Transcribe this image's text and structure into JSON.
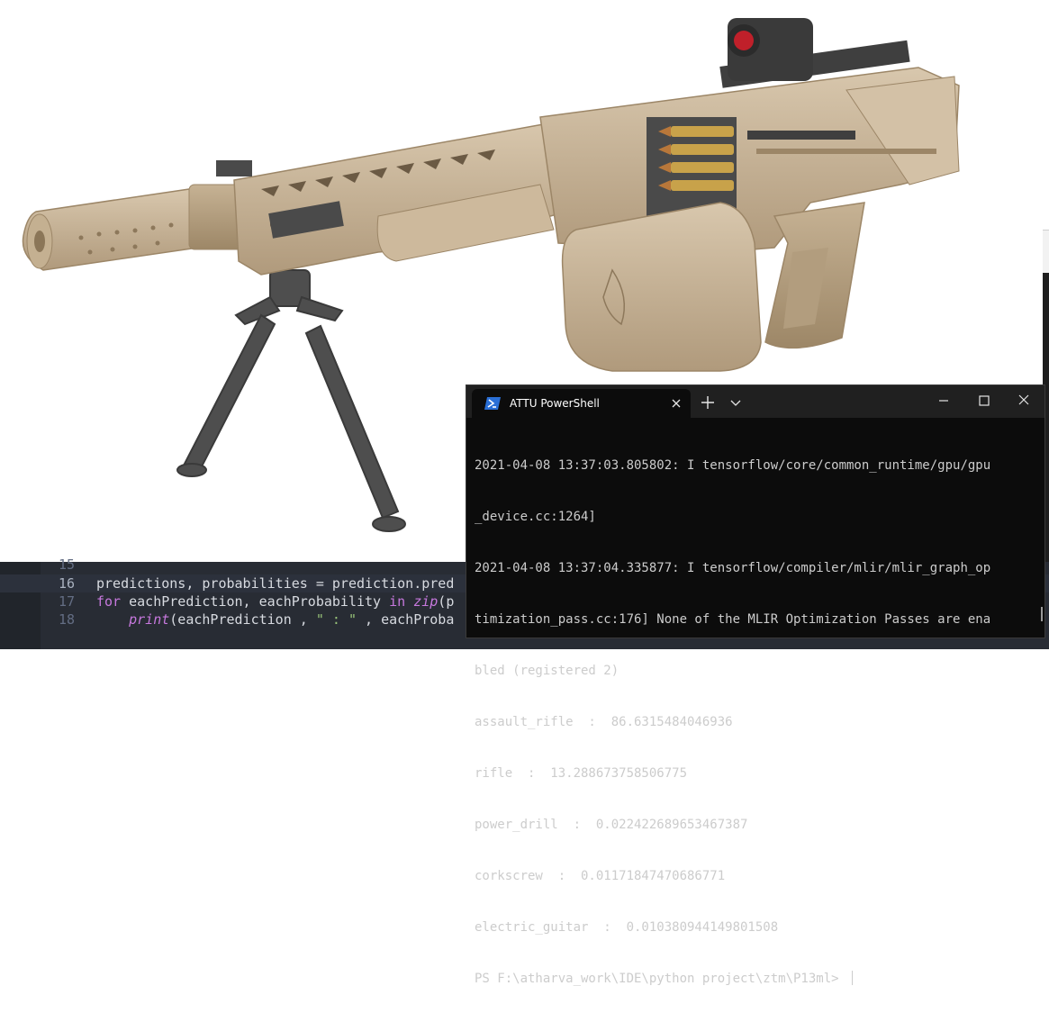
{
  "colors": {
    "editor_bg": "#282c34",
    "terminal_bg": "#0c0c0c",
    "tab_bar_bg": "#202020",
    "rifle_tan": "#c9b69b",
    "bipod_gray": "#4e4e4e",
    "keyword": "#c678dd",
    "function": "#61afef",
    "string": "#98c379"
  },
  "image_viewer": {
    "icons": [
      "rifle-image",
      "bipod",
      "red-dot-sight",
      "suppressor",
      "ammo-box"
    ]
  },
  "code_editor": {
    "lines": [
      {
        "number": "15",
        "tokens": []
      },
      {
        "number": "16",
        "tokens": [
          {
            "text": "predictions, probabilities = prediction.pred",
            "kind": "pl"
          }
        ]
      },
      {
        "number": "17",
        "tokens": [
          {
            "text": "for",
            "kind": "kw"
          },
          {
            "text": " eachPrediction, eachProbability ",
            "kind": "pl"
          },
          {
            "text": "in",
            "kind": "kw"
          },
          {
            "text": " ",
            "kind": "pl"
          },
          {
            "text": "zip",
            "kind": "it"
          },
          {
            "text": "(p",
            "kind": "pl"
          }
        ]
      },
      {
        "number": "18",
        "tokens": [
          {
            "text": "    ",
            "kind": "pl"
          },
          {
            "text": "print",
            "kind": "it"
          },
          {
            "text": "(eachPrediction , ",
            "kind": "pl"
          },
          {
            "text": "\" : \"",
            "kind": "str"
          },
          {
            "text": " , eachProba",
            "kind": "pl"
          }
        ]
      }
    ]
  },
  "terminal": {
    "tab_title": "ATTU PowerShell",
    "tab_icon": "powershell-icon",
    "buttons": {
      "new_tab": "plus-icon",
      "dropdown": "chevron-down-icon",
      "minimize": "minimize-icon",
      "maximize": "maximize-icon",
      "close": "close-icon"
    },
    "output_lines": [
      "2021-04-08 13:37:03.805802: I tensorflow/core/common_runtime/gpu/gpu",
      "_device.cc:1264]",
      "2021-04-08 13:37:04.335877: I tensorflow/compiler/mlir/mlir_graph_op",
      "timization_pass.cc:176] None of the MLIR Optimization Passes are ena",
      "bled (registered 2)",
      "assault_rifle  :  86.6315484046936",
      "rifle  :  13.288673758506775",
      "power_drill  :  0.022422689653467387",
      "corkscrew  :  0.01171847470686771",
      "electric_guitar  :  0.010380944149801508"
    ],
    "prompt": "PS F:\\atharva_work\\IDE\\python project\\ztm\\P13ml> "
  }
}
